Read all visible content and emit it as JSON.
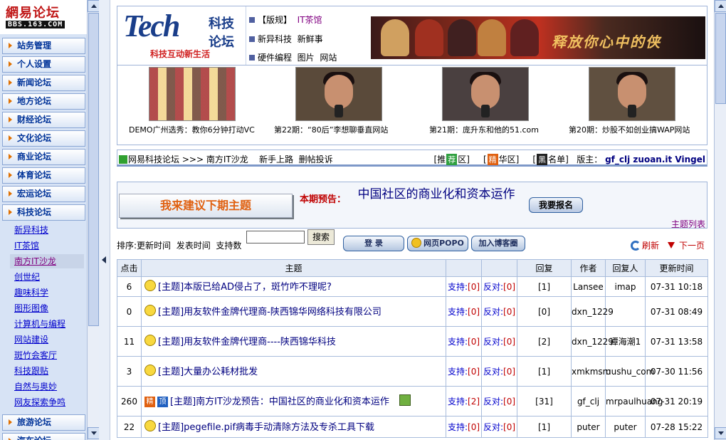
{
  "logo": {
    "cn": "網易论坛",
    "url": "BBS.163.COM"
  },
  "sidebar": {
    "top_items": [
      "站务管理",
      "个人设置",
      "新闻论坛",
      "地方论坛",
      "财经论坛",
      "文化论坛",
      "商业论坛",
      "体育论坛",
      "宏运论坛",
      "科技论坛"
    ],
    "sub_items": [
      "新异科技",
      "IT茶馆",
      "南方IT沙龙",
      "创世纪",
      "趣味科学",
      "图形图像",
      "计算机与编程",
      "网站建设",
      "斑竹会客厅",
      "科技跟贴",
      "自然与奥妙",
      "网友探索争鸣"
    ],
    "active_sub": "南方IT沙龙",
    "bottom_items": [
      "旅游论坛",
      "汽车论坛"
    ]
  },
  "header": {
    "tech_logo": "Tech",
    "tech_kj": "科技",
    "tech_lt": "论坛",
    "tech_slogan": "科技互动新生活",
    "links": [
      {
        "a": "【版规】",
        "b": "IT茶馆"
      },
      {
        "a": "新异科技",
        "b": "新鲜事"
      },
      {
        "a": "硬件编程",
        "b": "图片",
        "c": "网站"
      }
    ],
    "banner_text": "释放你心中的侠"
  },
  "photos": [
    "DEMO广州选秀：教你6分钟打动VC",
    "第22期：“80后”李想聊垂直网站",
    "第21期：庞升东和他的51.com",
    "第20期：炒股不如创业搞WAP网站"
  ],
  "breadcrumb": {
    "forum": "网易科技论坛",
    "sep": ">>>",
    "board": "南方IT沙龙",
    "newbie": "新手上路",
    "complain": "删帖投诉",
    "tag1": "荐",
    "tag1_after": "区]",
    "tag2": "精",
    "tag2_after": "华区]",
    "tag3": "黑",
    "tag3_after": "名单]",
    "mods_label": "版主：",
    "mods": "gf_clj zuoan.it Vingel"
  },
  "promo": {
    "suggest": "我来建议下期主题",
    "label": "本期预告：",
    "topic": "中国社区的商业化和资本运作",
    "signup": "我要报名",
    "topic_list": "主题列表"
  },
  "toolbar": {
    "sort_label": "排序:",
    "sort_options": [
      "更新时间",
      "发表时间",
      "支持数"
    ],
    "search_value": "",
    "search_btn": "搜索",
    "login": "登 录",
    "popo": "网页POPO",
    "blog": "加入博客圈",
    "refresh": "刷新",
    "next_page": "下一页"
  },
  "table": {
    "headers": [
      "点击",
      "主题",
      "",
      "",
      "回复",
      "作者",
      "回复人",
      "更新时间"
    ],
    "rows": [
      {
        "clicks": "6",
        "subject": "[主题]本版已给AD侵占了，斑竹咋不理呢?",
        "support": "支持:",
        "support_n": "[0]",
        "oppose": "反对:",
        "oppose_n": "[0]",
        "replies": "[1]",
        "author": "Lansee",
        "replier": "imap",
        "time": "07-31 10:18"
      },
      {
        "clicks": "0",
        "subject": "[主题]用友软件金牌代理商-陕西锦华网络科技有限公司",
        "support": "支持:",
        "support_n": "[0]",
        "oppose": "反对:",
        "oppose_n": "[0]",
        "replies": "[0]",
        "author": "dxn_1229",
        "replier": "",
        "time": "07-31 08:49"
      },
      {
        "clicks": "11",
        "subject": "[主题]用友软件金牌代理商----陕西锦华科技",
        "support": "支持:",
        "support_n": "[0]",
        "oppose": "反对:",
        "oppose_n": "[0]",
        "replies": "[2]",
        "author": "dxn_1229",
        "replier": "谭海潮1",
        "time": "07-31 13:58"
      },
      {
        "clicks": "3",
        "subject": "[主题]大量办公耗材批发",
        "support": "支持:",
        "support_n": "[0]",
        "oppose": "反对:",
        "oppose_n": "[0]",
        "replies": "[1]",
        "author": "xmkmsm",
        "replier": "uushu_com",
        "time": "07-30 11:56"
      },
      {
        "clicks": "260",
        "subject": "[主题]南方IT沙龙预告：中国社区的商业化和资本运作",
        "support": "支持:",
        "support_n": "[2]",
        "oppose": "反对:",
        "oppose_n": "[0]",
        "replies": "[31]",
        "author": "gf_clj",
        "replier": "mrpaulhuang",
        "time": "07-31 20:19",
        "badges": [
          "精",
          "顶"
        ],
        "has_img": true
      },
      {
        "clicks": "22",
        "subject": "[主题]pegefile.pif病毒手动清除方法及专杀工具下载",
        "support": "支持:",
        "support_n": "[0]",
        "oppose": "反对:",
        "oppose_n": "[0]",
        "replies": "[1]",
        "author": "puter",
        "replier": "puter",
        "time": "07-28 15:22"
      }
    ]
  }
}
